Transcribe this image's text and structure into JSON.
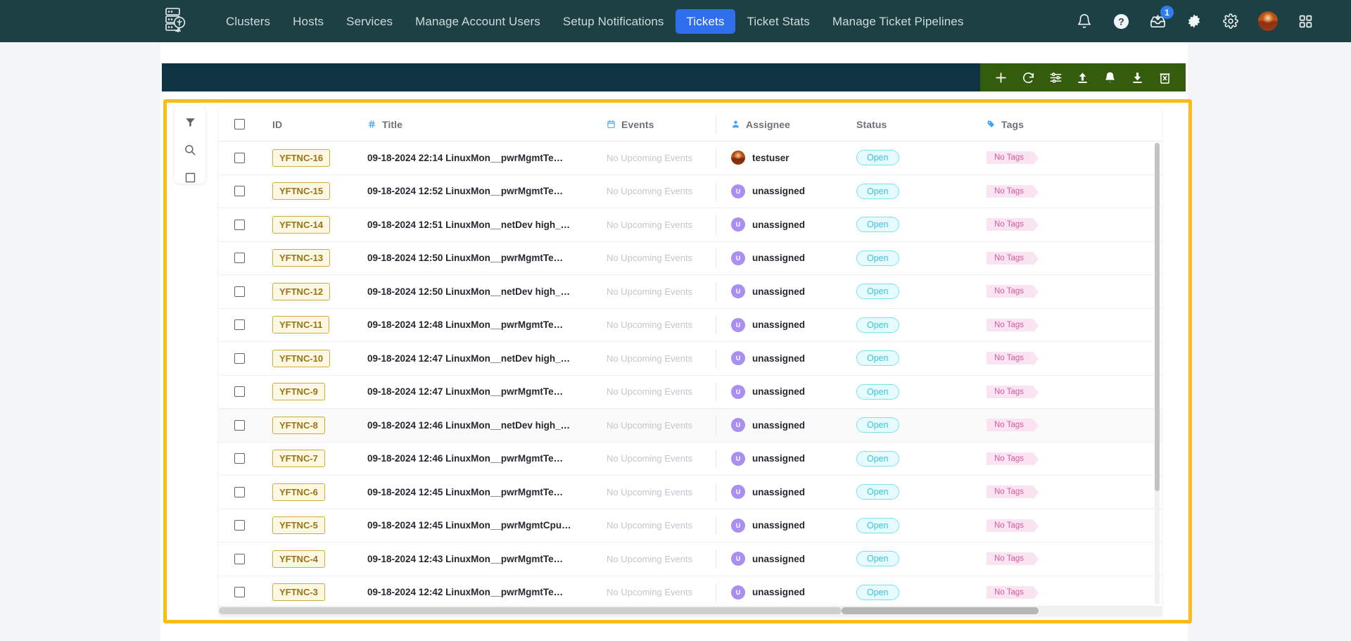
{
  "nav": {
    "logo_icon": "server-rack-icon",
    "links": [
      {
        "label": "Clusters",
        "active": false
      },
      {
        "label": "Hosts",
        "active": false
      },
      {
        "label": "Services",
        "active": false
      },
      {
        "label": "Manage Account Users",
        "active": false
      },
      {
        "label": "Setup Notifications",
        "active": false
      },
      {
        "label": "Tickets",
        "active": true
      },
      {
        "label": "Ticket Stats",
        "active": false
      },
      {
        "label": "Manage Ticket Pipelines",
        "active": false
      }
    ],
    "icons": [
      {
        "name": "notification-bell-icon",
        "badge": null
      },
      {
        "name": "help-circle-icon",
        "badge": null
      },
      {
        "name": "inbox-download-icon",
        "badge": "1"
      },
      {
        "name": "dark-mode-toggle-icon",
        "badge": null
      },
      {
        "name": "settings-gear-icon",
        "badge": null
      },
      {
        "name": "user-avatar",
        "badge": null
      },
      {
        "name": "app-grid-icon",
        "badge": null
      }
    ],
    "active_accent": "#2f6fed",
    "background": "#1d4044"
  },
  "action_bar": {
    "left_background": "#0e3444",
    "right_background": "#335c0c",
    "buttons": [
      {
        "name": "add-ticket-button",
        "icon": "plus-icon"
      },
      {
        "name": "refresh-button",
        "icon": "refresh-icon"
      },
      {
        "name": "filter-settings-button",
        "icon": "sliders-icon"
      },
      {
        "name": "upload-button",
        "icon": "upload-arrow-icon"
      },
      {
        "name": "alert-button",
        "icon": "bell-icon"
      },
      {
        "name": "download-button",
        "icon": "download-arrow-icon"
      },
      {
        "name": "delete-button",
        "icon": "trash-x-icon"
      }
    ]
  },
  "tool_rail": {
    "items": [
      {
        "name": "filter-icon"
      },
      {
        "name": "search-icon"
      },
      {
        "name": "column-select-icon"
      }
    ]
  },
  "highlight": {
    "color": "#fcbe16"
  },
  "grid": {
    "columns": [
      {
        "key": "check",
        "label": "",
        "icon": "checkbox-icon"
      },
      {
        "key": "id",
        "label": "ID",
        "icon": null
      },
      {
        "key": "title",
        "label": "Title",
        "icon": "hash-icon"
      },
      {
        "key": "events",
        "label": "Events",
        "icon": "calendar-icon"
      },
      {
        "key": "assignee",
        "label": "Assignee",
        "icon": "person-icon"
      },
      {
        "key": "status",
        "label": "Status",
        "icon": null
      },
      {
        "key": "tags",
        "label": "Tags",
        "icon": "tag-icon"
      }
    ],
    "rows": [
      {
        "id": "YFTNC-16",
        "title": "09-18-2024 22:14 LinuxMon__pwrMgmtTe…",
        "events": "No Upcoming Events",
        "assignee": "testuser",
        "avatar": "testuser",
        "status": "Open",
        "tags": "No Tags"
      },
      {
        "id": "YFTNC-15",
        "title": "09-18-2024 12:52 LinuxMon__pwrMgmtTe…",
        "events": "No Upcoming Events",
        "assignee": "unassigned",
        "avatar": "unassigned",
        "status": "Open",
        "tags": "No Tags"
      },
      {
        "id": "YFTNC-14",
        "title": "09-18-2024 12:51 LinuxMon__netDev high_…",
        "events": "No Upcoming Events",
        "assignee": "unassigned",
        "avatar": "unassigned",
        "status": "Open",
        "tags": "No Tags"
      },
      {
        "id": "YFTNC-13",
        "title": "09-18-2024 12:50 LinuxMon__pwrMgmtTe…",
        "events": "No Upcoming Events",
        "assignee": "unassigned",
        "avatar": "unassigned",
        "status": "Open",
        "tags": "No Tags"
      },
      {
        "id": "YFTNC-12",
        "title": "09-18-2024 12:50 LinuxMon__netDev high_…",
        "events": "No Upcoming Events",
        "assignee": "unassigned",
        "avatar": "unassigned",
        "status": "Open",
        "tags": "No Tags"
      },
      {
        "id": "YFTNC-11",
        "title": "09-18-2024 12:48 LinuxMon__pwrMgmtTe…",
        "events": "No Upcoming Events",
        "assignee": "unassigned",
        "avatar": "unassigned",
        "status": "Open",
        "tags": "No Tags"
      },
      {
        "id": "YFTNC-10",
        "title": "09-18-2024 12:47 LinuxMon__netDev high_…",
        "events": "No Upcoming Events",
        "assignee": "unassigned",
        "avatar": "unassigned",
        "status": "Open",
        "tags": "No Tags"
      },
      {
        "id": "YFTNC-9",
        "title": "09-18-2024 12:47 LinuxMon__pwrMgmtTe…",
        "events": "No Upcoming Events",
        "assignee": "unassigned",
        "avatar": "unassigned",
        "status": "Open",
        "tags": "No Tags"
      },
      {
        "id": "YFTNC-8",
        "title": "09-18-2024 12:46 LinuxMon__netDev high_…",
        "events": "No Upcoming Events",
        "assignee": "unassigned",
        "avatar": "unassigned",
        "status": "Open",
        "tags": "No Tags"
      },
      {
        "id": "YFTNC-7",
        "title": "09-18-2024 12:46 LinuxMon__pwrMgmtTe…",
        "events": "No Upcoming Events",
        "assignee": "unassigned",
        "avatar": "unassigned",
        "status": "Open",
        "tags": "No Tags"
      },
      {
        "id": "YFTNC-6",
        "title": "09-18-2024 12:45 LinuxMon__pwrMgmtTe…",
        "events": "No Upcoming Events",
        "assignee": "unassigned",
        "avatar": "unassigned",
        "status": "Open",
        "tags": "No Tags"
      },
      {
        "id": "YFTNC-5",
        "title": "09-18-2024 12:45 LinuxMon__pwrMgmtCpu…",
        "events": "No Upcoming Events",
        "assignee": "unassigned",
        "avatar": "unassigned",
        "status": "Open",
        "tags": "No Tags"
      },
      {
        "id": "YFTNC-4",
        "title": "09-18-2024 12:43 LinuxMon__pwrMgmtTe…",
        "events": "No Upcoming Events",
        "assignee": "unassigned",
        "avatar": "unassigned",
        "status": "Open",
        "tags": "No Tags"
      },
      {
        "id": "YFTNC-3",
        "title": "09-18-2024 12:42 LinuxMon__pwrMgmtTe…",
        "events": "No Upcoming Events",
        "assignee": "unassigned",
        "avatar": "unassigned",
        "status": "Open",
        "tags": "No Tags"
      }
    ],
    "highlighted_row_index": 8,
    "status_color": "#3dc3d8",
    "tag_color": "#d45aa0",
    "id_chip_color": "#9a7312"
  }
}
